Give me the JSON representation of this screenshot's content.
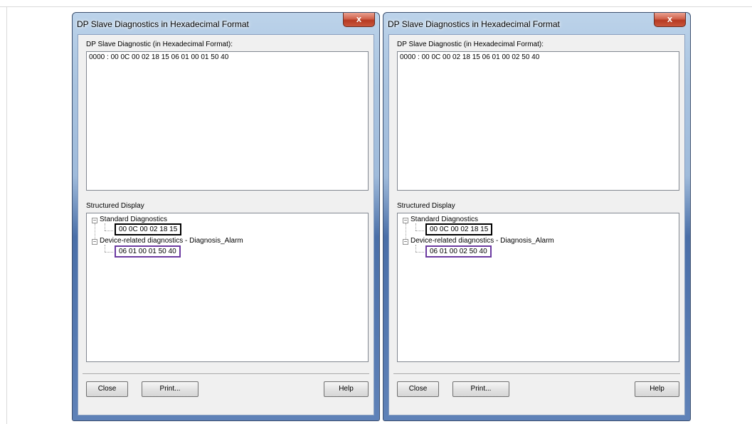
{
  "dialogs": [
    {
      "title": "DP Slave Diagnostics in Hexadecimal Format",
      "close_symbol": "x",
      "hex_label": "DP Slave Diagnostic (in Hexadecimal Format):",
      "hex_line": "0000 :   00 0C 00 02 18 15 06 01 00 01 50 40",
      "structured_label": "Structured Display",
      "tree": {
        "standard_label": "Standard Diagnostics",
        "standard_value": "00 0C 00 02 18 15",
        "device_label": "Device-related diagnostics - Diagnosis_Alarm",
        "device_value": "06 01 00 01 50 40"
      },
      "buttons": {
        "close": "Close",
        "print": "Print...",
        "help": "Help"
      }
    },
    {
      "title": "DP Slave Diagnostics in Hexadecimal Format",
      "close_symbol": "x",
      "hex_label": "DP Slave Diagnostic (in Hexadecimal Format):",
      "hex_line": "0000 :   00 0C 00 02 18 15 06 01 00 02 50 40",
      "structured_label": "Structured Display",
      "tree": {
        "standard_label": "Standard Diagnostics",
        "standard_value": "00 0C 00 02 18 15",
        "device_label": "Device-related diagnostics - Diagnosis_Alarm",
        "device_value": "06 01 00 02 50 40"
      },
      "buttons": {
        "close": "Close",
        "print": "Print...",
        "help": "Help"
      }
    }
  ],
  "colors": {
    "highlight_standard": "#000000",
    "highlight_device": "#6b3aa0",
    "close_button": "#c8553c"
  },
  "icons": {
    "window_close": "close-icon",
    "tree_expander": "minus-box-icon"
  }
}
